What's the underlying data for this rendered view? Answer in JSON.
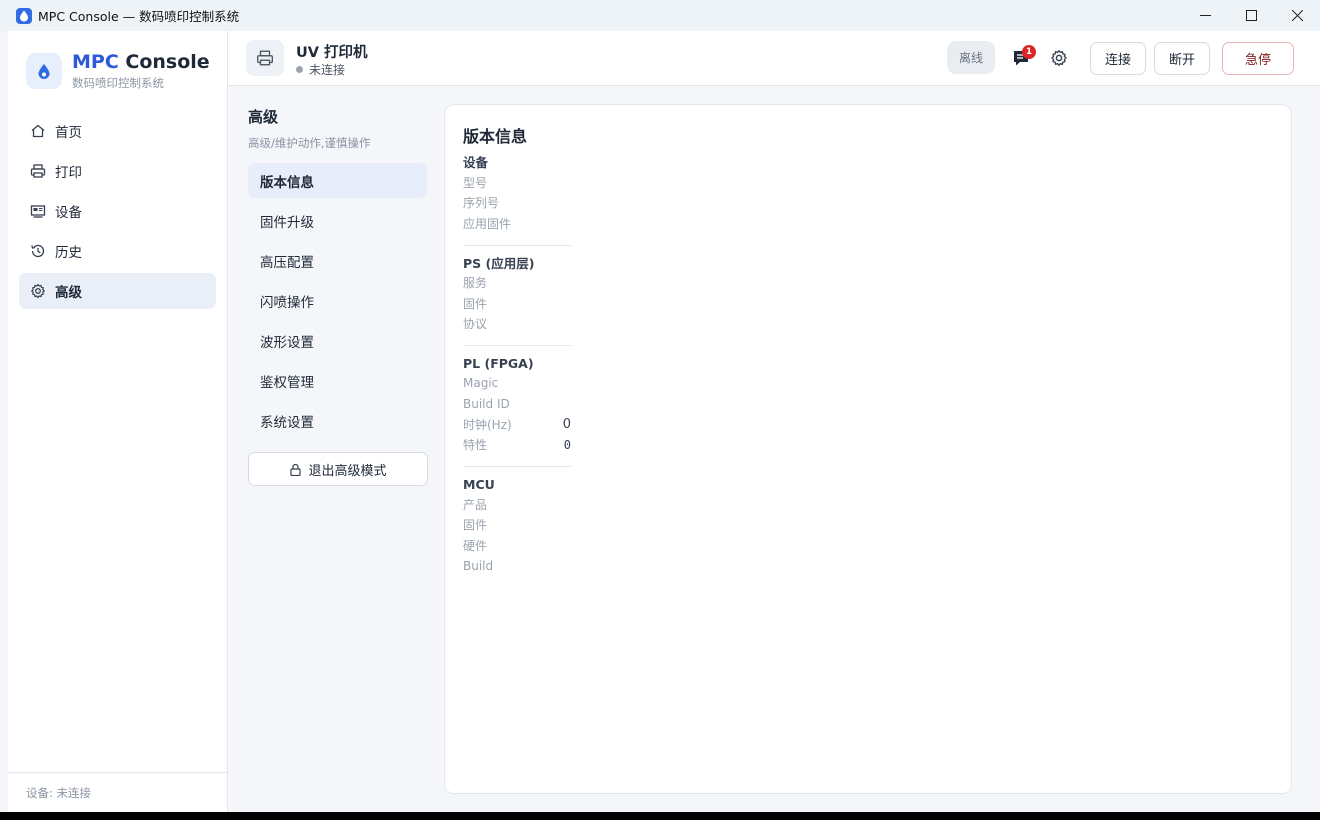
{
  "window": {
    "title": "MPC Console — 数码喷印控制系统",
    "controls": {
      "minimize": "—",
      "maximize": "☐",
      "close": "✕"
    }
  },
  "brand": {
    "title_accent": "MPC",
    "title_rest": "Console",
    "subtitle": "数码喷印控制系统"
  },
  "nav": {
    "items": [
      {
        "label": "首页",
        "icon": "home-icon"
      },
      {
        "label": "打印",
        "icon": "printer-icon"
      },
      {
        "label": "设备",
        "icon": "device-icon"
      },
      {
        "label": "历史",
        "icon": "history-icon"
      },
      {
        "label": "高级",
        "icon": "gear-icon",
        "active": true
      }
    ]
  },
  "sidebar_footer": "设备: 未连接",
  "header": {
    "device_name": "UV 打印机",
    "status": "未连接",
    "offline_label": "离线",
    "notification_count": "1",
    "connect_label": "连接",
    "disconnect_label": "断开",
    "estop_label": "急停"
  },
  "subnav": {
    "title": "高级",
    "desc": "高级/维护动作,谨慎操作",
    "items": [
      {
        "label": "版本信息",
        "active": true
      },
      {
        "label": "固件升级"
      },
      {
        "label": "高压配置"
      },
      {
        "label": "闪喷操作"
      },
      {
        "label": "波形设置"
      },
      {
        "label": "鉴权管理"
      },
      {
        "label": "系统设置"
      }
    ],
    "exit_label": "退出高级模式"
  },
  "content": {
    "title": "版本信息",
    "sections": [
      {
        "title": "设备",
        "rows": [
          {
            "label": "型号",
            "value": ""
          },
          {
            "label": "序列号",
            "value": ""
          },
          {
            "label": "应用固件",
            "value": ""
          }
        ]
      },
      {
        "title": "PS (应用层)",
        "rows": [
          {
            "label": "服务",
            "value": ""
          },
          {
            "label": "固件",
            "value": ""
          },
          {
            "label": "协议",
            "value": ""
          }
        ]
      },
      {
        "title": "PL (FPGA)",
        "rows": [
          {
            "label": "Magic",
            "value": ""
          },
          {
            "label": "Build ID",
            "value": ""
          },
          {
            "label": "时钟(Hz)",
            "value": "0"
          },
          {
            "label": "特性",
            "value": "0"
          }
        ]
      },
      {
        "title": "MCU",
        "rows": [
          {
            "label": "产品",
            "value": ""
          },
          {
            "label": "固件",
            "value": ""
          },
          {
            "label": "硬件",
            "value": ""
          },
          {
            "label": "Build",
            "value": ""
          }
        ]
      }
    ]
  },
  "colors": {
    "accent": "#2e5ad9",
    "active_bg": "#e9eef7",
    "badge": "#dc2626",
    "estop_border": "#e8b4b4"
  }
}
